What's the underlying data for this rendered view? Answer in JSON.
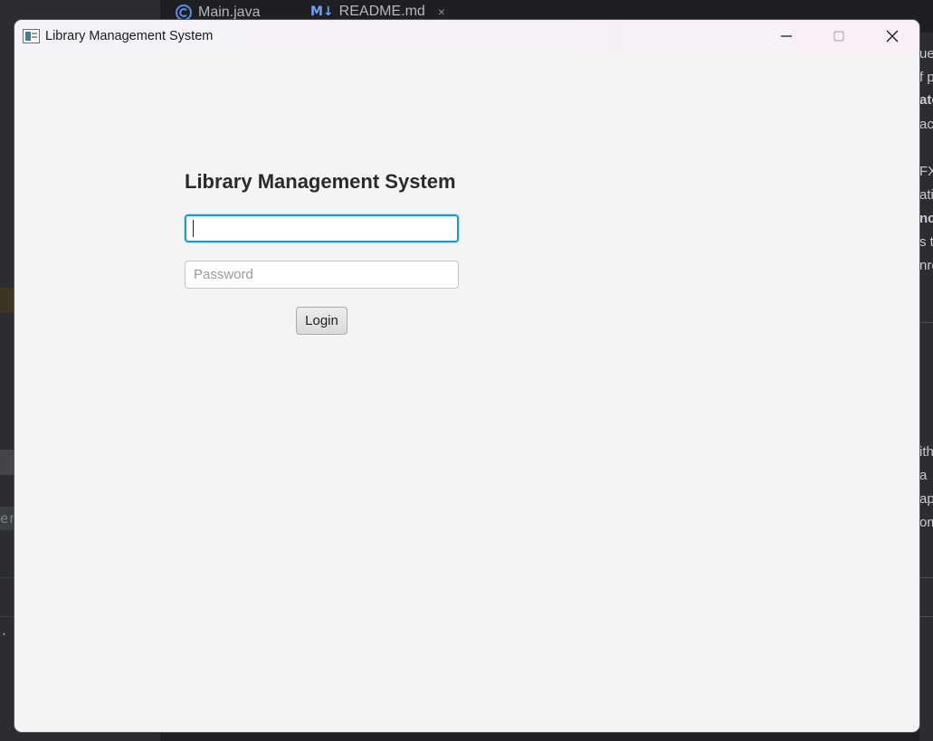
{
  "ide": {
    "tabs": [
      {
        "label": "Main.java",
        "icon": "java-class-icon"
      },
      {
        "label": "README.md",
        "icon": "markdown-icon",
        "badge": "M↓",
        "close": "×"
      }
    ],
    "left_fragments": [
      "er",
      ". 1"
    ],
    "right_fragments": [
      "ue",
      "f p",
      "ato",
      "ac",
      "FX",
      "ati",
      "nc",
      "s t",
      "nro",
      "ith",
      "a",
      "ap",
      "om"
    ]
  },
  "window": {
    "title": "Library Management System",
    "icon": "javafx-app-icon",
    "controls": [
      "minimize-icon",
      "maximize-icon",
      "close-icon"
    ]
  },
  "login": {
    "heading": "Library Management System",
    "username_value": "",
    "password_placeholder": "Password",
    "login_label": "Login"
  },
  "colors": {
    "focus_border": "#1a9ad6",
    "window_bg": "#f4f4f4",
    "ide_bg": "#1e1f22"
  }
}
